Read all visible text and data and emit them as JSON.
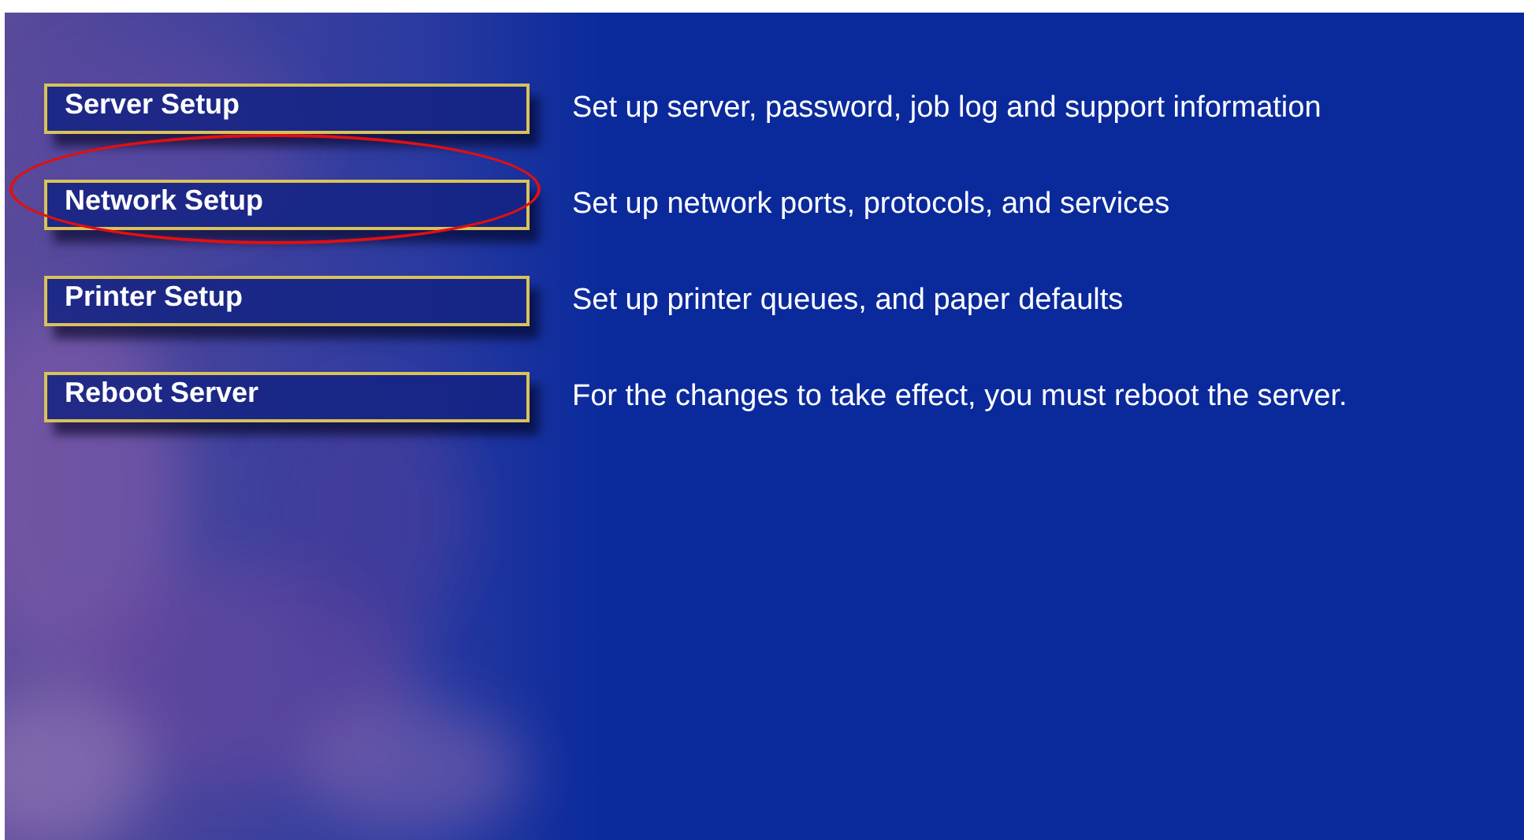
{
  "menu": [
    {
      "label": "Server Setup",
      "description": "Set up server, password, job log and support information",
      "highlighted": false
    },
    {
      "label": "Network Setup",
      "description": "Set up network ports, protocols, and services",
      "highlighted": true
    },
    {
      "label": "Printer Setup",
      "description": "Set up printer queues, and paper defaults",
      "highlighted": false
    },
    {
      "label": "Reboot Server",
      "description": "For the changes to take effect, you must reboot the server.",
      "highlighted": false
    }
  ]
}
